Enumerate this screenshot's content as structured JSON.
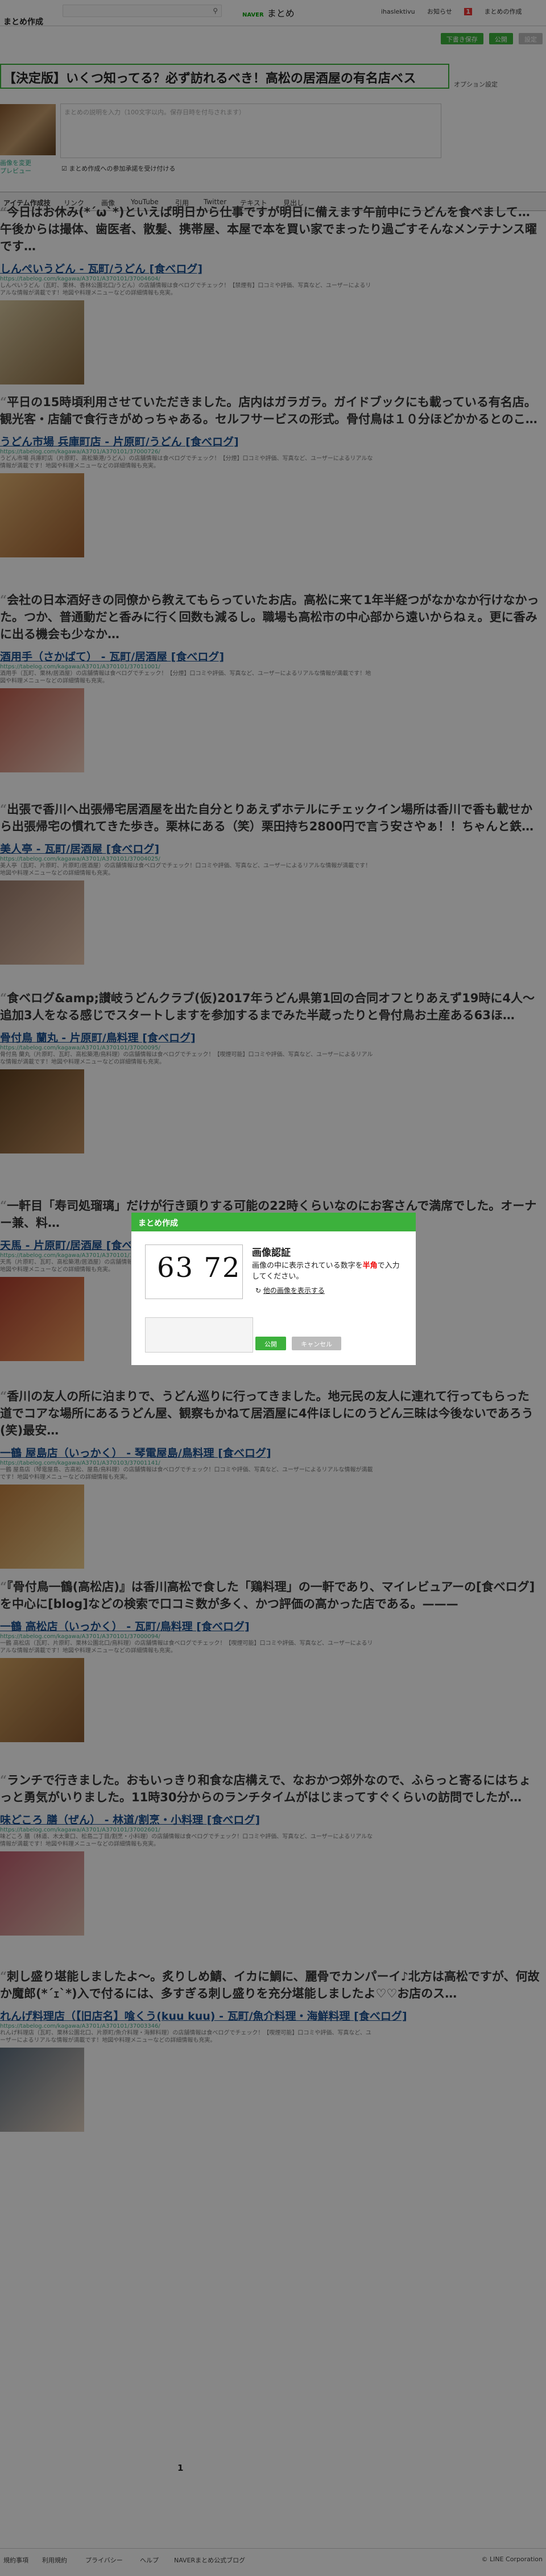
{
  "header": {
    "brand": "まとめ作成",
    "search_icon": "search-icon",
    "logo_small": "NAVER",
    "logo": "まとめ",
    "user": "ihaslektivu",
    "news": "お知らせ",
    "news_count": "1",
    "mine": "まとめの作成",
    "btn_preview": "下書き保存",
    "btn_public": "公開",
    "btn_delete": "設定"
  },
  "title": "【決定版】いくつ知ってる？必ず訪れるべき！高松の居酒屋の有名店ベス",
  "option_label": "オプション設定",
  "description_placeholder": "まとめの説明を入力（100文字以内。保存日時を付与されます）",
  "thumb_buttons": [
    "画像を変更",
    "プレビュー"
  ],
  "checkbox_label": "まとめ作成への参加承諾を受け付ける",
  "toolbar": [
    "アイテム作成技",
    "リンク",
    "画像",
    "YouTube",
    "引用",
    "Twitter",
    "テキスト",
    "見出し"
  ],
  "items": [
    {
      "quote": "今日はお休み(*´ω`*)といえば明日から仕事ですが明日に備えます午前中にうどんを食べまして…午後からは撮体、歯医者、散髪、携帯屋、本屋で本を買い家でまったり過ごすそんなメンテナンス曜です…",
      "link": "しんぺいうどん - 瓦町/うどん [食べログ]",
      "url": "https://tabelog.com/kagawa/A3701/A370101/37004604/",
      "desc": "しんぺいうどん（瓦町、栗林、香林公園北口/うどん）の店舗情報は食べログでチェック！【禁煙有】口コミや評価、写真など、ユーザーによるリアルな情報が満載です！地図や料理メニューなどの詳細情報も充実。"
    },
    {
      "quote": "平日の15時頃利用させていただきました。店内はガラガラ。ガイドブックにも載っている有名店。観光客・店舗で食行きがめっちゃある。セルフサービスの形式。骨付鳥は１０分ほどかかるとのこ…",
      "link": "うどん市場 兵庫町店 - 片原町/うどん [食べログ]",
      "url": "https://tabelog.com/kagawa/A3701/A370101/37000726/",
      "desc": "うどん市場 兵庫町店（片原町、高松築港/うどん）の店舗情報は食べログでチェック！【分煙】口コミや評価、写真など、ユーザーによるリアルな情報が満載です！地図や料理メニューなどの詳細情報も充実。"
    },
    {
      "quote": "会社の日本酒好きの同僚から教えてもらっていたお店。高松に来て1年半経つがなかなか行けなかった。つか、普通動だと香みに行く回数も減るし。職場も高松市の中心部から遠いからねぇ。更に香みに出る機会も少なか…",
      "link": "酒用手（さかばて） - 瓦町/居酒屋 [食べログ]",
      "url": "https://tabelog.com/kagawa/A3701/A370101/37011001/",
      "desc": "酒用手（瓦町、栗林/居酒屋）の店舗情報は食べログでチェック！【分煙】口コミや評価、写真など、ユーザーによるリアルな情報が満載です！地図や料理メニューなどの詳細情報も充実。"
    },
    {
      "quote": "出張で香川へ出張帰宅居酒屋を出た自分とりあえずホテルにチェックイン場所は香川で香も載せから出張帰宅の慣れてきた歩き。栗林にある（笑）栗田持ち2800円で言う安さやぁ！！ちゃんと鉄…",
      "link": "美人亭 - 瓦町/居酒屋 [食べログ]",
      "url": "https://tabelog.com/kagawa/A3701/A370101/37004025/",
      "desc": "美人亭（瓦町、片原町、片原町/居酒屋）の店舗情報は食べログでチェック！口コミや評価、写真など、ユーザーによるリアルな情報が満載です！地図や料理メニューなどの詳細情報も充実。"
    },
    {
      "quote": "食ベログ&amp;讃岐うどんクラブ(仮)2017年うどん県第1回の合同オフとりあえず19時に4人〜追加3人をなる感じでスタートしますを参加するまでみた半蔵ったりと骨付鳥お土産ある63ほ…",
      "link": "骨付鳥 蘭丸 - 片原町/鳥料理 [食べログ]",
      "url": "https://tabelog.com/kagawa/A3701/A370101/37000095/",
      "desc": "骨付鳥 蘭丸（片原町、瓦町、高松築港/鳥料理）の店舗情報は食べログでチェック！【喫煙可能】口コミや評価、写真など、ユーザーによるリアルな情報が満載です！地図や料理メニューなどの詳細情報も充実。"
    },
    {
      "quote": "一軒目「寿司処瑠璃」だけが行き頭りする可能の22時くらいなのにお客さんで満席でした。オーナー兼、料…",
      "link": "天馬 - 片原町/居酒屋 [食べログ]",
      "url": "https://tabelog.com/kagawa/A3701/A370101/37003434/",
      "desc": "天馬（片原町、瓦町、高松築港/居酒屋）の店舗情報は食べログでチェック！口コミや評価、写真など、ユーザーによるリアルな情報が満載です！地図や料理メニューなどの詳細情報も充実。"
    },
    {
      "quote": "香川の友人の所に泊まりで、うどん巡りに行ってきました。地元民の友人に連れて行ってもらった道でコアな場所にあるうどん屋、観察もかねて居酒屋に4件ほしにのうどん三昧は今後ないであろう(笑)最安…",
      "link": "一鶴 屋島店（いっかく） - 琴電屋島/鳥料理 [食べログ]",
      "url": "https://tabelog.com/kagawa/A3701/A370103/37001141/",
      "desc": "一鶴 屋島店（琴電屋島、古高松、屋島/鳥料理）の店舗情報は食べログでチェック！口コミや評価、写真など、ユーザーによるリアルな情報が満載です！地図や料理メニューなどの詳細情報も充実。"
    },
    {
      "quote": "『骨付鳥一鶴(高松店)』は香川高松で食した「鶏料理」の一軒であり、マイレビュアーの[食べログ]を中心に[blog]などの検索で口コミ数が多く、かつ評価の高かった店である。———",
      "link": "一鶴 高松店（いっかく） - 瓦町/鳥料理 [食べログ]",
      "url": "https://tabelog.com/kagawa/A3701/A370101/37000094/",
      "desc": "一鶴 高松店（瓦町、片原町、栗林公園北口/鳥料理）の店舗情報は食べログでチェック！【喫煙可能】口コミや評価、写真など、ユーザーによるリアルな情報が満載です！地図や料理メニューなどの詳細情報も充実。"
    },
    {
      "quote": "ランチで行きました。おもいっきり和食な店構えで、なおかつ郊外なので、ふらっと寄るにはちょっと勇気がいりました。11時30分からのランチタイムがはじまってすぐくらいの訪問でしたが…",
      "link": "味どころ 膳（ぜん） - 林道/割烹・小料理 [食べログ]",
      "url": "https://tabelog.com/kagawa/A3701/A370101/37002601/",
      "desc": "味どころ 膳（林道、木太東口、松島二丁目/割烹・小料理）の店舗情報は食べログでチェック！口コミや評価、写真など、ユーザーによるリアルな情報が満載です！地図や料理メニューなどの詳細情報も充実。"
    },
    {
      "quote": "刺し盛り堪能しましたよ〜。炙りしめ鯖、イカに鯛に、麗骨でカンパーイ♪北方は高松ですが、何故か魔郎(*´ｪ`*)入で付るには、多すぎる刺し盛りを充分堪能しましたよ♡♡お店のス…",
      "link": "れんげ料理店（【旧店名】喰くう(kuu kuu) - 瓦町/魚介料理・海鮮料理 [食べログ]",
      "url": "https://tabelog.com/kagawa/A3701/A370101/37003346/",
      "desc": "れんげ料理店（瓦町、栗林公園北口、片原町/魚介料理・海鮮料理）の店舗情報は食べログでチェック！【喫煙可能】口コミや評価、写真など、ユーザーによるリアルな情報が満載です！地図や料理メニューなどの詳細情報も充実。"
    }
  ],
  "pager": "1",
  "footer": [
    "規約事項",
    "利用規約",
    "プライバシー",
    "ヘルプ",
    "NAVERまとめ公式ブログ",
    "© LINE Corporation"
  ],
  "modal": {
    "header": "まとめ作成",
    "captcha_text": "63 72",
    "title": "画像認証",
    "desc_pre": "画像の中に表示されている数字を",
    "desc_em": "半角",
    "desc_post": "で入力してください。",
    "link": "他の画像を表示する",
    "submit": "公開",
    "cancel": "キャンセル"
  }
}
